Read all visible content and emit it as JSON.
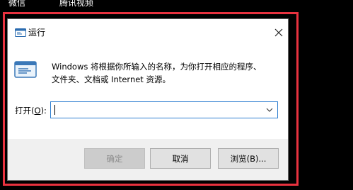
{
  "taskbar": {
    "items": [
      {
        "label": "微信"
      },
      {
        "label": "腾讯视频"
      }
    ]
  },
  "dialog": {
    "title": "运行",
    "message_line1": "Windows 将根据你所输入的名称，为你打开相应的程序、",
    "message_line2": "文件夹、文档或 Internet 资源。",
    "open_label_prefix": "打开(",
    "open_label_key": "O",
    "open_label_suffix": "):",
    "open_value": "",
    "buttons": {
      "ok": "确定",
      "cancel": "取消",
      "browse": "浏览(B)..."
    }
  },
  "colors": {
    "highlight": "#e8323f",
    "focus_border": "#2f7fd1",
    "button_bar": "#f0f0f0"
  },
  "icons": [
    "run-app-icon",
    "close-icon",
    "dropdown-chevron-icon"
  ]
}
